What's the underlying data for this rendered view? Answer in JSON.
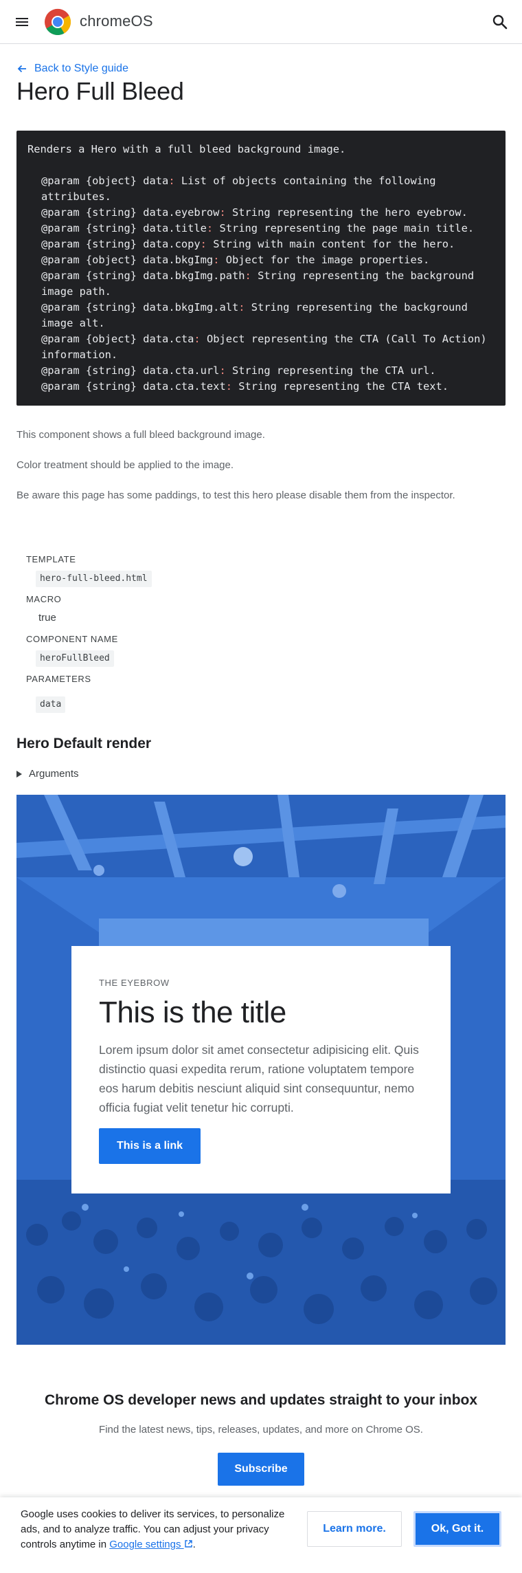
{
  "header": {
    "brand": "chromeOS",
    "menu_icon": "hamburger-menu-icon",
    "logo_icon": "chrome-logo-icon",
    "search_icon": "search-icon"
  },
  "back_link": {
    "label": "Back to Style guide",
    "icon": "arrow-back-icon"
  },
  "page_title": "Hero Full Bleed",
  "code": {
    "intro": "Renders a Hero with a full bleed background image.",
    "params": [
      {
        "type": "@param {object} data",
        "sep": ":",
        "desc": " List of objects containing the following attributes."
      },
      {
        "type": "@param {string} data.eyebrow",
        "sep": ":",
        "desc": " String representing the hero eyebrow."
      },
      {
        "type": "@param {string} data.title",
        "sep": ":",
        "desc": " String representing the page main title."
      },
      {
        "type": "@param {string} data.copy",
        "sep": ":",
        "desc": " String with main content for the hero."
      },
      {
        "type": "@param {object} data.bkgImg",
        "sep": ":",
        "desc": " Object for the image properties."
      },
      {
        "type": "@param {string} data.bkgImg.path",
        "sep": ":",
        "desc": " String representing the background image path."
      },
      {
        "type": "@param {string} data.bkgImg.alt",
        "sep": ":",
        "desc": " String representing the background image alt."
      },
      {
        "type": "@param {object} data.cta",
        "sep": ":",
        "desc": " Object representing the CTA (Call To Action) information."
      },
      {
        "type": "@param {string} data.cta.url",
        "sep": ":",
        "desc": " String representing the CTA url."
      },
      {
        "type": "@param {string} data.cta.text",
        "sep": ":",
        "desc": " String representing the CTA text."
      }
    ]
  },
  "description": {
    "line1": "This component shows a full bleed background image.",
    "line2": "Color treatment should be applied to the image.",
    "line3": "Be aware this page has some paddings, to test this hero please disable them from the inspector."
  },
  "meta": {
    "template_label": "TEMPLATE",
    "template_value": "hero-full-bleed.html",
    "macro_label": "MACRO",
    "macro_value": "true",
    "component_label": "COMPONENT NAME",
    "component_value": "heroFullBleed",
    "parameters_label": "PARAMETERS",
    "parameters_value": "data"
  },
  "render_section": {
    "title": "Hero Default render",
    "arguments_label": "Arguments"
  },
  "hero": {
    "eyebrow": "THE EYEBROW",
    "title": "This is the title",
    "copy": "Lorem ipsum dolor sit amet consectetur adipisicing elit. Quis distinctio quasi expedita rerum, ratione voluptatem tempore eos harum debitis nesciunt aliquid sint consequuntur, nemo officia fugiat velit tenetur hic corrupti.",
    "cta": "This is a link",
    "tint_color": "#2f6fd1"
  },
  "newsletter": {
    "title": "Chrome OS developer news and updates straight to your inbox",
    "subtitle": "Find the latest news, tips, releases, updates, and more on Chrome OS.",
    "button": "Subscribe"
  },
  "cookie": {
    "text": "Google uses cookies to deliver its services, to personalize ads, and to analyze traffic. You can adjust your privacy controls anytime in ",
    "link": "Google settings",
    "link_icon": "external-link-icon",
    "period": ".",
    "learn_more": "Learn more.",
    "accept": "Ok, Got it."
  },
  "colors": {
    "accent": "#1a73e8",
    "code_bg": "#202124",
    "code_punct": "#f28b82"
  }
}
